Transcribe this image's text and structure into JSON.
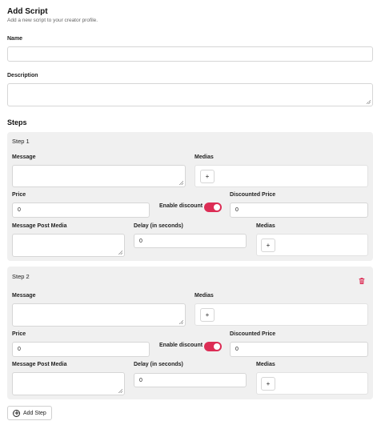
{
  "header": {
    "title": "Add Script",
    "subtitle": "Add a new script to your creator profile."
  },
  "form": {
    "name_label": "Name",
    "name_value": "",
    "description_label": "Description",
    "description_value": ""
  },
  "steps_heading": "Steps",
  "steps": [
    {
      "title": "Step 1",
      "message_label": "Message",
      "medias_label": "Medias",
      "add_media_label": "+",
      "price_label": "Price",
      "price_value": "0",
      "enable_discount_label": "Enable discount",
      "enable_discount_on": true,
      "discounted_price_label": "Discounted Price",
      "discounted_price_value": "0",
      "post_media_label": "Message Post Media",
      "delay_label": "Delay (in seconds)",
      "delay_value": "0",
      "post_medias_label": "Medias",
      "post_add_media_label": "+"
    },
    {
      "title": "Step 2",
      "message_label": "Message",
      "medias_label": "Medias",
      "add_media_label": "+",
      "price_label": "Price",
      "price_value": "0",
      "enable_discount_label": "Enable discount",
      "enable_discount_on": true,
      "discounted_price_label": "Discounted Price",
      "discounted_price_value": "0",
      "post_media_label": "Message Post Media",
      "delay_label": "Delay (in seconds)",
      "delay_value": "0",
      "post_medias_label": "Medias",
      "post_add_media_label": "+",
      "delete_icon": "trash-icon"
    }
  ],
  "add_step_label": "Add Step",
  "colors": {
    "accent": "#dc2d55",
    "card_bg": "#f0f0f0",
    "border": "#d6d6d6"
  }
}
